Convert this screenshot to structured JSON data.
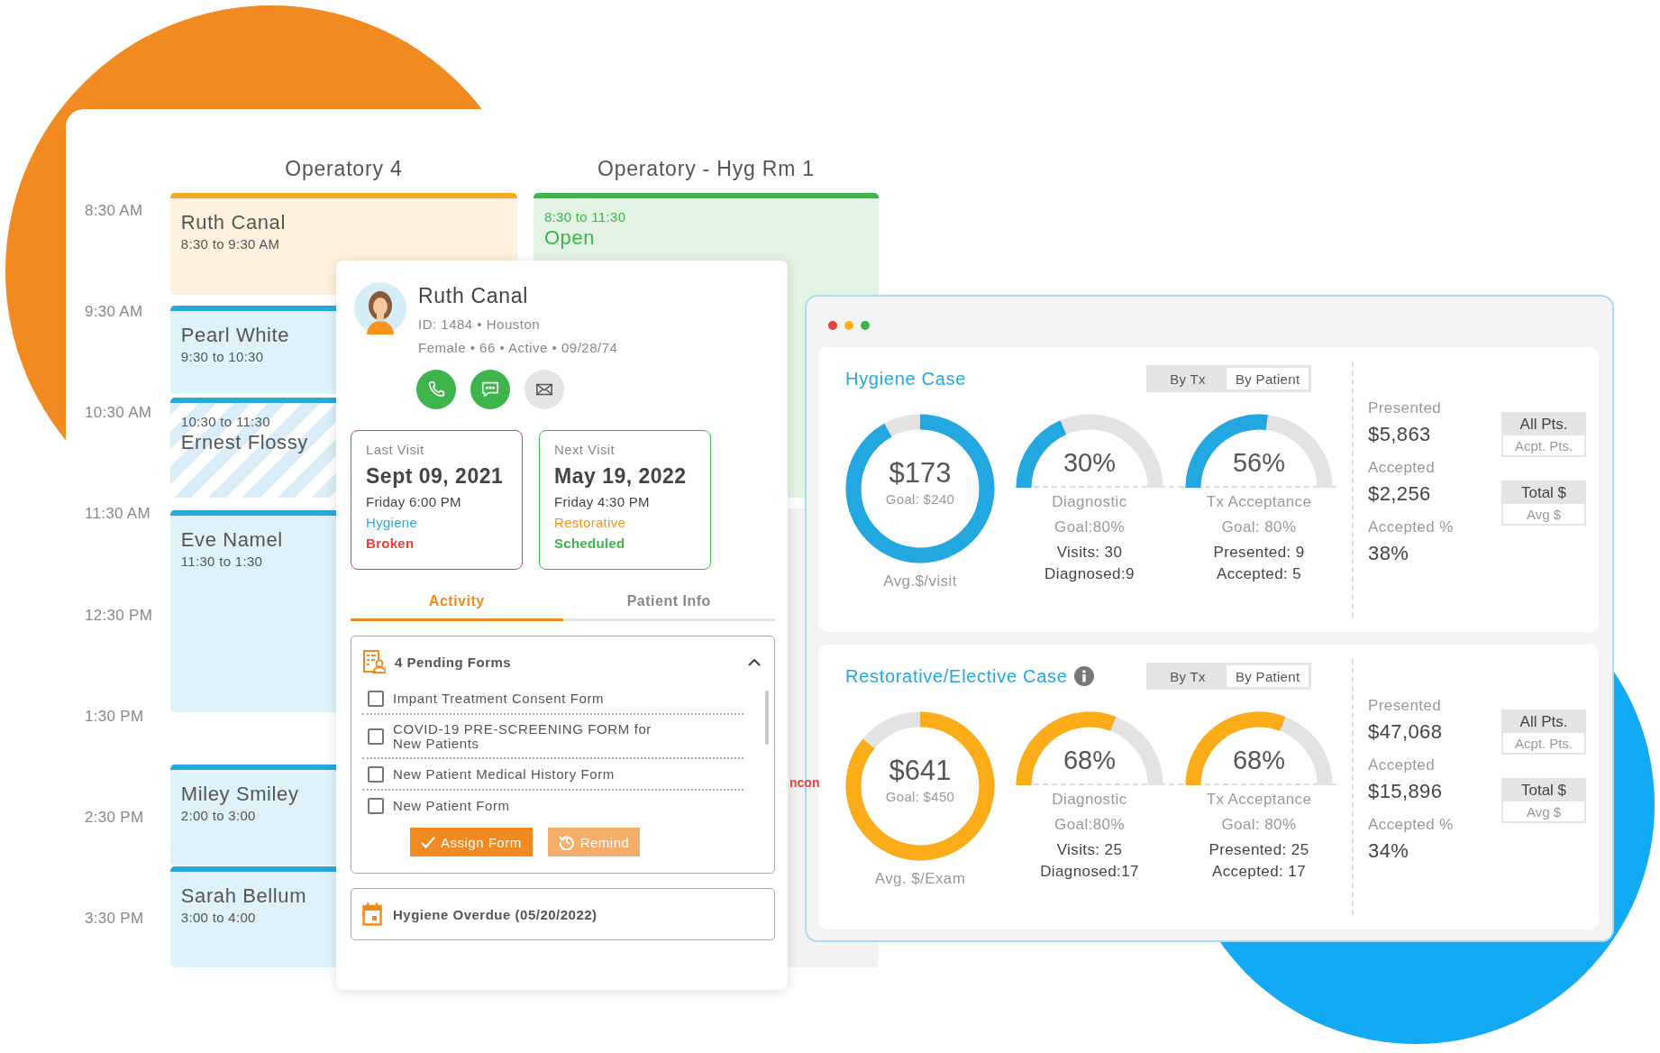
{
  "schedule": {
    "times": [
      "8:30 AM",
      "9:30 AM",
      "10:30 AM",
      "11:30 AM",
      "12:30 PM",
      "1:30 PM",
      "2:30 PM",
      "3:30 PM"
    ],
    "columns": [
      {
        "title": "Operatory 4",
        "appointments": [
          {
            "kind": "booked",
            "name": "Ruth Canal",
            "time": "8:30 to 9:30 AM",
            "color": "#f7a823"
          },
          {
            "kind": "booked",
            "name": "Pearl White",
            "time": "9:30 to 10:30",
            "color": "#29a8e0"
          },
          {
            "kind": "striped",
            "name": "Ernest Flossy",
            "time": "10:30 to 11:30",
            "color": "#29a8e0"
          },
          {
            "kind": "booked",
            "name": "Eve Namel",
            "time": "11:30 to 1:30",
            "color": "#29a8e0"
          },
          {
            "kind": "booked",
            "name": "Miley Smiley",
            "time": "2:00 to 3:00",
            "color": "#29a8e0"
          },
          {
            "kind": "booked",
            "name": "Sarah Bellum",
            "time": "3:00 to 4:00",
            "color": "#29a8e0"
          }
        ]
      },
      {
        "title": "Operatory - Hyg Rm 1",
        "appointments": [
          {
            "kind": "open",
            "name": "Open",
            "time": "8:30 to 11:30",
            "color": "#3db54a"
          }
        ],
        "partial_text": "ncon"
      }
    ]
  },
  "patient_card": {
    "name": "Ruth Canal",
    "details": [
      "ID: 1484 • Houston",
      "Female • 66 • Active • 09/28/74"
    ],
    "actions": [
      {
        "kind": "phone",
        "color": "#3db54a"
      },
      {
        "kind": "message",
        "color": "#3db54a"
      },
      {
        "kind": "email",
        "color": "#e4e4e4"
      }
    ],
    "visits": [
      {
        "label": "Last Visit",
        "date": "Sept 09, 2021",
        "time": "Friday 6:00 PM",
        "type": {
          "label": "Hygiene",
          "color": "#29a8e0"
        },
        "status": "Broken",
        "color": "#e8413c"
      },
      {
        "label": "Next Visit",
        "date": "May 19, 2022",
        "time": "Friday 4:30 PM",
        "type": {
          "label": "Restorative",
          "color": "#f7941d"
        },
        "status": "Scheduled",
        "color": "#3db54a"
      }
    ],
    "tabs": [
      {
        "label": "Activity",
        "selected": true
      },
      {
        "label": "Patient Info",
        "selected": false
      }
    ],
    "forms_panel": {
      "title": "4 Pending Forms",
      "expanded": true,
      "forms": [
        {
          "label": "Impant Treatment Consent Form",
          "checked": false
        },
        {
          "label": "COVID-19 PRE-SCREENING FORM for New Patients",
          "checked": false
        },
        {
          "label": "New Patient Medical History Form",
          "checked": false
        },
        {
          "label": "New Patient Form",
          "checked": false
        }
      ],
      "buttons": [
        {
          "kind": "primary",
          "label": "Assign Form"
        },
        {
          "kind": "secondary",
          "label": "Remind"
        }
      ]
    },
    "reminder": "Hygiene Overdue (05/20/2022)"
  },
  "dashboard": {
    "panels": [
      {
        "title": "Hygiene Case",
        "info": false,
        "color": "#22a7e0",
        "toggle": [
          {
            "label": "By Tx",
            "selected": true
          },
          {
            "label": "By Patient",
            "selected": false
          }
        ],
        "donut": {
          "value": "$173",
          "goal": "Goal: $240",
          "caption": "Avg.$/visit",
          "level": 0.92
        },
        "gauges": [
          {
            "value": "30%",
            "level": 0.3,
            "label": "Diagnostic",
            "goal": "Goal:80%",
            "stats": [
              "Visits: 30",
              "Diagnosed:9"
            ]
          },
          {
            "value": "56%",
            "level": 0.56,
            "label": "Tx Acceptance",
            "goal": "Goal: 80%",
            "stats": [
              "Presented: 9",
              "Accepted: 5"
            ]
          }
        ],
        "summary": [
          {
            "label": "Presented",
            "value": "$5,863"
          },
          {
            "label": "Accepted",
            "value": "$2,256"
          },
          {
            "label": "Accepted %",
            "value": "38%"
          }
        ],
        "filters": [
          [
            {
              "label": "All Pts.",
              "selected": true
            },
            {
              "label": "Acpt. Pts.",
              "selected": false
            }
          ],
          [
            {
              "label": "Total $",
              "selected": true
            },
            {
              "label": "Avg $",
              "selected": false
            }
          ]
        ]
      },
      {
        "title": "Restorative/Elective Case",
        "info": true,
        "color": "#fbac18",
        "toggle": [
          {
            "label": "By Tx",
            "selected": true
          },
          {
            "label": "By Patient",
            "selected": false
          }
        ],
        "donut": {
          "value": "$641",
          "goal": "Goal: $450",
          "caption": "Avg. $/Exam",
          "level": 0.86
        },
        "gauges": [
          {
            "value": "68%",
            "level": 0.68,
            "label": "Diagnostic",
            "goal": "Goal:80%",
            "stats": [
              "Visits: 25",
              "Diagnosed:17"
            ]
          },
          {
            "value": "68%",
            "level": 0.68,
            "label": "Tx Acceptance",
            "goal": "Goal: 80%",
            "stats": [
              "Presented: 25",
              "Accepted: 17"
            ]
          }
        ],
        "summary": [
          {
            "label": "Presented",
            "value": "$47,068"
          },
          {
            "label": "Accepted",
            "value": "$15,896"
          },
          {
            "label": "Accepted %",
            "value": "34%"
          }
        ],
        "filters": [
          [
            {
              "label": "All Pts.",
              "selected": true
            },
            {
              "label": "Acpt. Pts.",
              "selected": false
            }
          ],
          [
            {
              "label": "Total $",
              "selected": true
            },
            {
              "label": "Avg $",
              "selected": false
            }
          ]
        ]
      }
    ]
  }
}
